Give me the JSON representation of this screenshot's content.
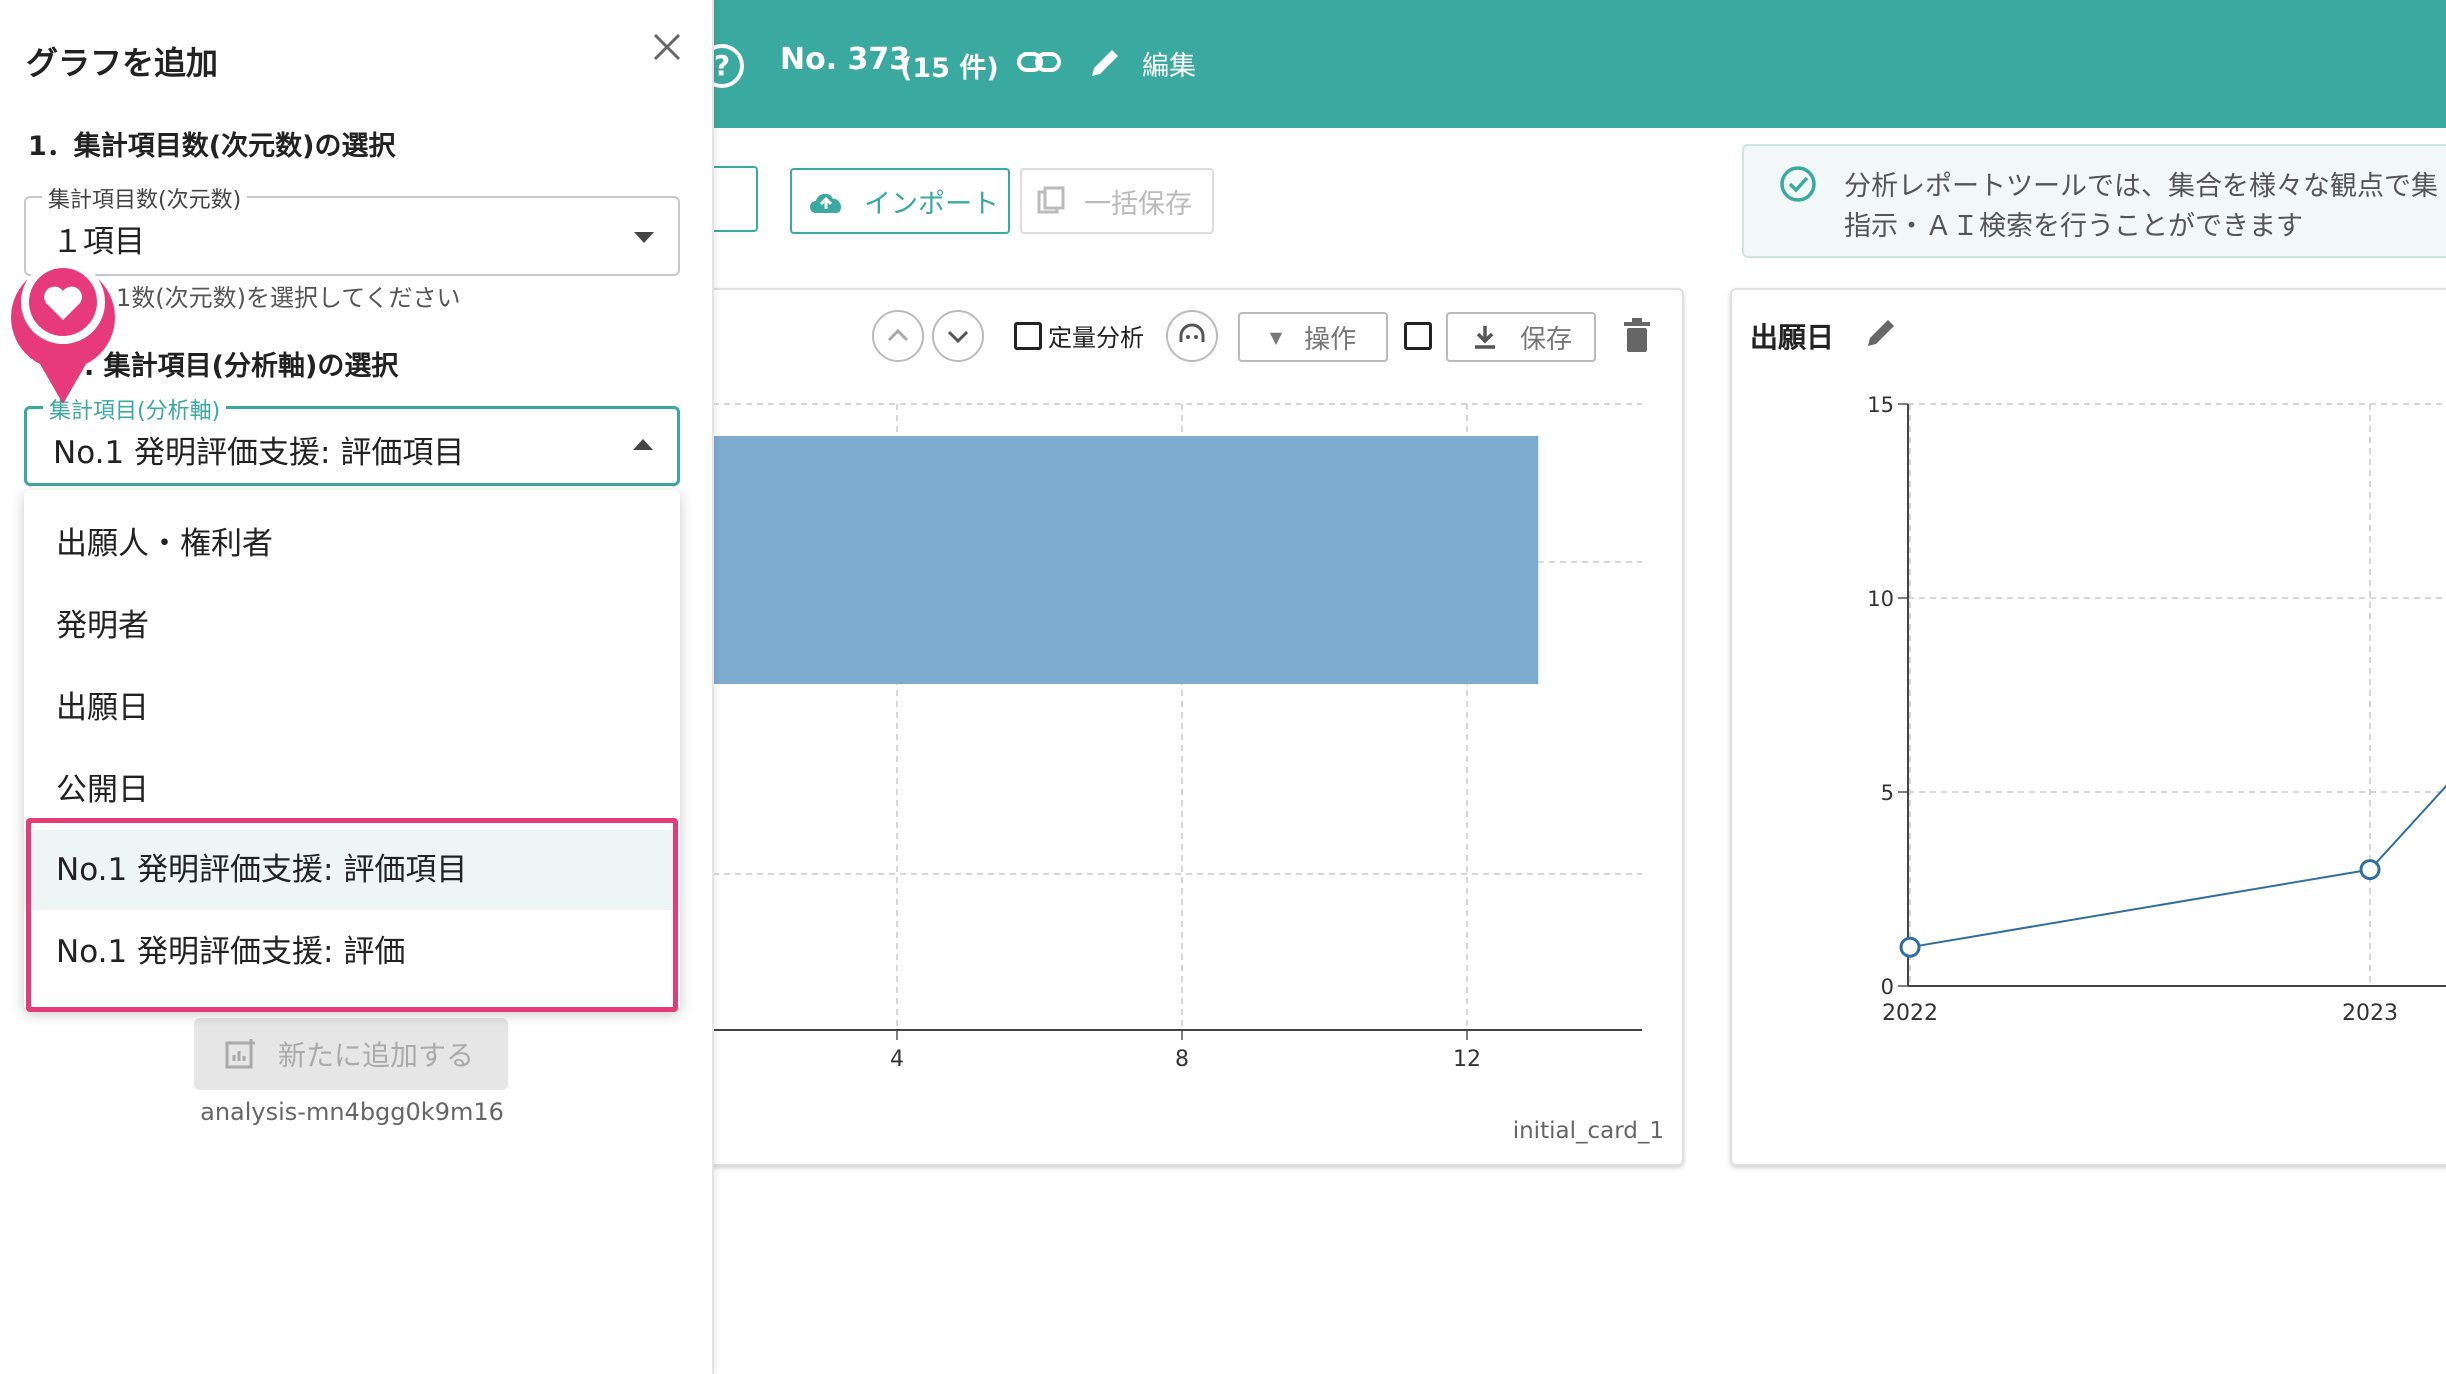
{
  "header": {
    "help_icon": "question-circle-icon",
    "record_no": "No. 373",
    "record_count": "(15 件)",
    "edit_label": "編集"
  },
  "toolbar": {
    "import_label": "インポート",
    "bulk_save_label": "一括保存"
  },
  "info": {
    "line1": "分析レポートツールでは、集合を様々な観点で集",
    "line2": "指示・ＡＩ検索を行うことができます"
  },
  "card1": {
    "quant_label": "定量分析",
    "operation_label": "操作",
    "save_label": "保存",
    "card_id": "initial_card_1",
    "chart_data": {
      "type": "bar",
      "orientation": "horizontal",
      "values": [
        13
      ],
      "xticks": [
        "4",
        "8",
        "12",
        "16"
      ],
      "xlim": [
        0,
        16
      ],
      "grid": true,
      "bar_color": "#7eabd0"
    }
  },
  "card2": {
    "title": "出願日",
    "chart_data": {
      "type": "line",
      "x": [
        "2022",
        "2023"
      ],
      "values": [
        1,
        3
      ],
      "yticks": [
        "0",
        "5",
        "10",
        "15"
      ],
      "ylim": [
        0,
        15
      ],
      "grid": true,
      "line_color": "#2f6f9f"
    }
  },
  "panel": {
    "title": "グラフを追加",
    "section1_title": "1．集計項目数(次元数)の選択",
    "dim_field_label": "集計項目数(次元数)",
    "dim_field_value": "１項目",
    "dim_helper": "1数(次元数)を選択してください",
    "section2_title": ".  集計項目(分析軸)の選択",
    "axis_field_label": "集計項目(分析軸)",
    "axis_field_value": "No.1 発明評価支援: 評価項目",
    "menu_items": [
      "出願人・権利者",
      "発明者",
      "出願日",
      "公開日",
      "No.1 発明評価支援: 評価項目",
      "No.1 発明評価支援: 評価"
    ],
    "add_button": "新たに追加する",
    "analysis_id": "analysis-mn4bgg0k9m16"
  },
  "colors": {
    "accent": "#3aa99f",
    "highlight": "#e63a7a",
    "bar": "#7eabd0"
  }
}
